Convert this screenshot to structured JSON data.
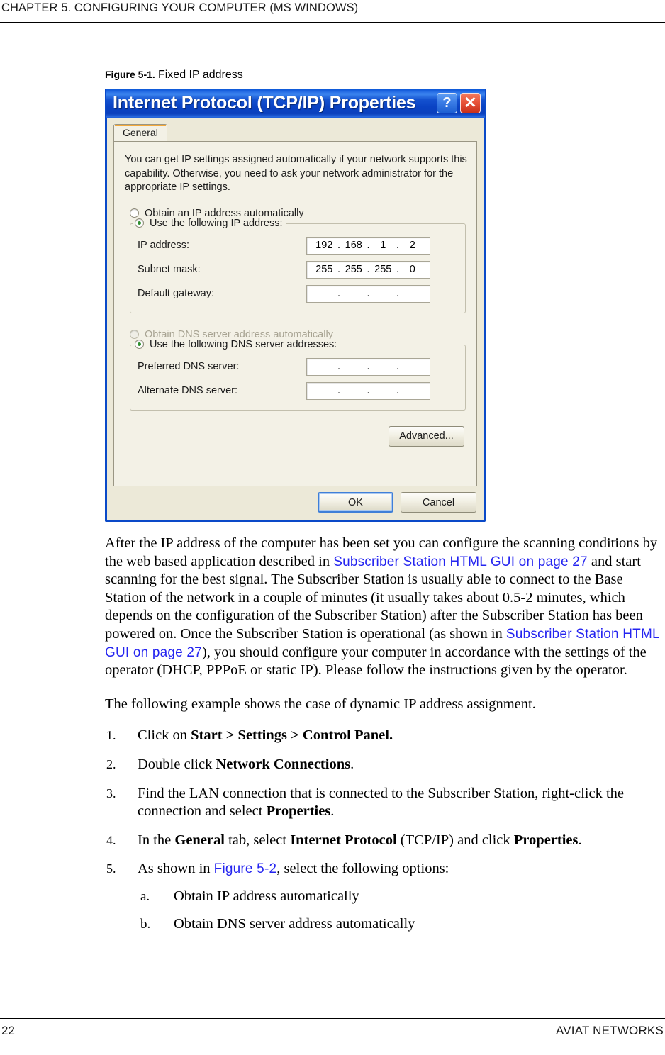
{
  "page": {
    "running_header": "CHAPTER 5. CONFIGURING YOUR COMPUTER (MS WINDOWS)",
    "page_number": "22",
    "company": "AVIAT NETWORKS"
  },
  "figure": {
    "number": "Figure 5-1.",
    "title": "Fixed IP address"
  },
  "dialog": {
    "title": "Internet Protocol (TCP/IP) Properties",
    "help_button": "?",
    "close_button": "✕",
    "tab": "General",
    "intro": "You can get IP settings assigned automatically if your network supports this capability. Otherwise, you need to ask your network administrator for the appropriate IP settings.",
    "ip_auto_radio": "Obtain an IP address automatically",
    "ip_manual_radio": "Use the following IP address:",
    "ip_address_label": "IP address:",
    "ip_address_value": [
      "192",
      "168",
      "1",
      "2"
    ],
    "subnet_mask_label": "Subnet mask:",
    "subnet_mask_value": [
      "255",
      "255",
      "255",
      "0"
    ],
    "default_gateway_label": "Default gateway:",
    "default_gateway_value": [
      "",
      "",
      "",
      ""
    ],
    "dns_auto_radio": "Obtain DNS server address automatically",
    "dns_manual_radio": "Use the following DNS server addresses:",
    "preferred_dns_label": "Preferred DNS server:",
    "preferred_dns_value": [
      "",
      "",
      "",
      ""
    ],
    "alternate_dns_label": "Alternate DNS server:",
    "alternate_dns_value": [
      "",
      "",
      "",
      ""
    ],
    "advanced_button": "Advanced...",
    "ok_button": "OK",
    "cancel_button": "Cancel",
    "colors": {
      "titlebar_blue": "#0a49c8",
      "face": "#ece9d8",
      "panel": "#f3f1e6",
      "tab_accent": "#f4a93a",
      "radio_dot_green": "#2f8f2f",
      "close_red": "#e8543a"
    }
  },
  "body": {
    "para1_part1": "After the IP address of the computer has been set you can configure the scanning conditions by the web based application described in ",
    "para1_link1": "Subscriber Station HTML GUI on page 27",
    "para1_part2": " and start scanning for the best signal. The Subscriber Station is usually able to connect to the Base Station of the network in a couple of minutes (it usually takes about 0.5-2 minutes, which depends on the configuration of the Subscriber Station) after the Subscriber Station has been powered on. Once the Subscriber Station is operational (as shown in ",
    "para1_link2": "Subscriber Station HTML GUI on page 27",
    "para1_part3": "), you should configure your computer in accordance with the settings of the operator (DHCP, PPPoE or static IP). Please follow the instructions given by the operator.",
    "para2": "The following example shows the case of dynamic IP address assignment.",
    "link_color": "#2424f0"
  },
  "steps": [
    {
      "marker": "1.",
      "segments": [
        {
          "text": "Click on ",
          "bold": false
        },
        {
          "text": "Start > Settings > Control Panel.",
          "bold": true
        }
      ]
    },
    {
      "marker": "2.",
      "segments": [
        {
          "text": "Double click ",
          "bold": false
        },
        {
          "text": "Network Connections",
          "bold": true
        },
        {
          "text": ".",
          "bold": false
        }
      ]
    },
    {
      "marker": "3.",
      "segments": [
        {
          "text": "Find the LAN connection that is connected to the Subscriber Station, right-click the connection and select ",
          "bold": false
        },
        {
          "text": "Properties",
          "bold": true
        },
        {
          "text": ".",
          "bold": false
        }
      ]
    },
    {
      "marker": "4.",
      "segments": [
        {
          "text": "In the ",
          "bold": false
        },
        {
          "text": "General",
          "bold": true
        },
        {
          "text": " tab, select ",
          "bold": false
        },
        {
          "text": "Internet Protocol",
          "bold": true
        },
        {
          "text": " (TCP/IP) and click ",
          "bold": false
        },
        {
          "text": "Properties",
          "bold": true
        },
        {
          "text": ".",
          "bold": false
        }
      ]
    },
    {
      "marker": "5.",
      "segments": [
        {
          "text": "As shown in ",
          "bold": false
        },
        {
          "text": "Figure 5-2",
          "link": true
        },
        {
          "text": ", select the following options:",
          "bold": false
        }
      ]
    }
  ],
  "substeps": [
    {
      "marker": "a.",
      "text": "Obtain IP address automatically"
    },
    {
      "marker": "b.",
      "text": "Obtain DNS server address automatically"
    }
  ]
}
